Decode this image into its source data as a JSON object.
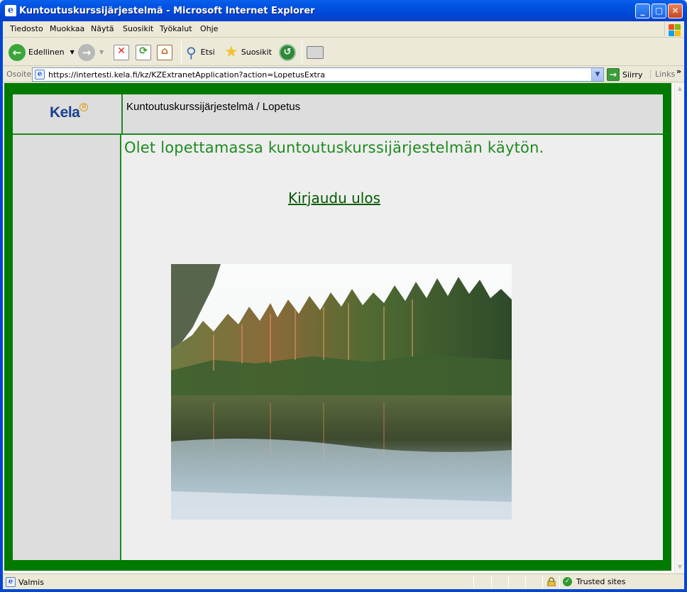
{
  "window": {
    "title": "Kuntoutuskurssijärjestelmä - Microsoft Internet Explorer",
    "buttons": [
      "minimize",
      "maximize",
      "close"
    ]
  },
  "menu": {
    "items": [
      "Tiedosto",
      "Muokkaa",
      "Näytä",
      "Suosikit",
      "Työkalut",
      "Ohje"
    ]
  },
  "toolbar": {
    "back_label": "Edellinen",
    "search_label": "Etsi",
    "favorites_label": "Suosikit"
  },
  "address": {
    "label": "Osoite",
    "url": "https://intertesti.kela.fi/kz/KZExtranetApplication?action=LopetusExtra",
    "go_label": "Siirry",
    "links_label": "Links"
  },
  "page": {
    "logo_text": "Kela",
    "title": "Kuntoutuskurssijärjestelmä / Lopetus",
    "message": "Olet lopettamassa kuntoutuskurssijärjestelmän käytön.",
    "logout_link": "Kirjaudu ulos"
  },
  "status": {
    "text": "Valmis",
    "zone": "Trusted sites"
  },
  "colors": {
    "frame_green": "#007A00",
    "text_green": "#1F8A1F",
    "link_green": "#005A00",
    "titlebar_blue": "#0053E3"
  }
}
